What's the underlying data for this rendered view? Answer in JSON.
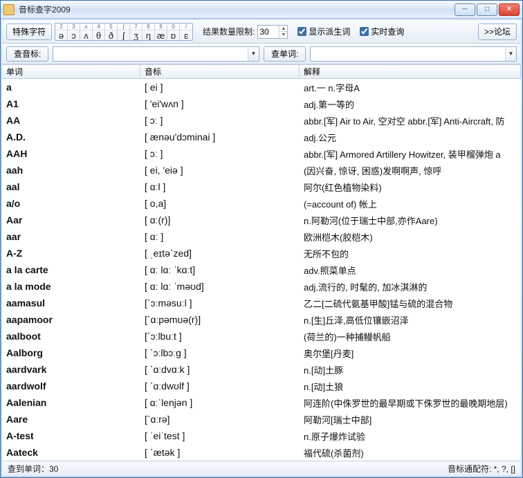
{
  "title": "音标查字2009",
  "winbtns": {
    "min": "─",
    "max": "□",
    "close": "✕"
  },
  "toolbar": {
    "special_label": "特殊字符",
    "ipa_cells": [
      {
        "n": "2",
        "s": "ə"
      },
      {
        "n": "3",
        "s": "ɔ"
      },
      {
        "n": "ʌ",
        "s": "ʌ"
      },
      {
        "n": "4",
        "s": "θ"
      },
      {
        "n": "5",
        "s": "ð"
      },
      {
        "n": "ʃ",
        "s": "ʃ"
      },
      {
        "n": "7",
        "s": "ʒ"
      },
      {
        "n": "8",
        "s": "ŋ"
      },
      {
        "n": "9",
        "s": "æ"
      },
      {
        "n": "0",
        "s": "ɒ"
      },
      {
        "n": "/",
        "s": "ɛ"
      }
    ],
    "limit_label": "结果数量限制:",
    "limit_value": "30",
    "chk_derive": "显示派生词",
    "chk_live": "实时查询",
    "forum_label": ">>论坛"
  },
  "searchbar": {
    "ipa_label": "查音标:",
    "ipa_value": "",
    "word_label": "查单词:",
    "word_value": ""
  },
  "columns": {
    "word": "单词",
    "ipa": "音标",
    "def": "解释"
  },
  "rows": [
    {
      "word": "a",
      "ipa": "[  ei ]",
      "def": "art.一  n.字母A"
    },
    {
      "word": "A1",
      "ipa": "[  'ei'wʌn ]",
      "def": "adj.第一等的"
    },
    {
      "word": "AA",
      "ipa": "[  ɔː ]",
      "def": "abbr.[军] Air to Air, 空对空  abbr.[军] Anti-Aircraft, 防"
    },
    {
      "word": "A.D.",
      "ipa": "[  ænəu'dɔminai ]",
      "def": "adj.公元"
    },
    {
      "word": "AAH",
      "ipa": "[  ɔː ]",
      "def": "abbr.[军] Armored Artillery Howitzer, 装甲榴弹炮  a"
    },
    {
      "word": "aah",
      "ipa": "[  ei, 'eiə ]",
      "def": "(因兴奋, 惊讶, 困惑)发啊啊声, 惊呼"
    },
    {
      "word": "aal",
      "ipa": "[  ɑːl ]",
      "def": "阿尔(红色植物染料)"
    },
    {
      "word": "a/o",
      "ipa": "[  o,a]",
      "def": "(=account of) 帐上"
    },
    {
      "word": "Aar",
      "ipa": "[ ɑː(r)]",
      "def": "n.阿勒河(位于瑞士中部,亦作Aare)"
    },
    {
      "word": "aar",
      "ipa": "[   ɑː ]",
      "def": "欧洲桤木(胶桤木)"
    },
    {
      "word": "A-Z",
      "ipa": "[  ˌeɪtəˋzed]",
      "def": "无所不包的"
    },
    {
      "word": "a la carte",
      "ipa": "[  ɑː lɑː ˈkɑːt]",
      "def": "adv.照菜单点"
    },
    {
      "word": "a la mode",
      "ipa": "[  ɑː lɑː ˈməʊd]",
      "def": "adj.流行的, 时髦的, 加冰淇淋的"
    },
    {
      "word": "aamasul",
      "ipa": "[ˋɔːməsuːl ]",
      "def": "乙二[二硫代氨基甲酸]锰与硫的混合物"
    },
    {
      "word": "aapamoor",
      "ipa": "[ˋɑːpəmʊə(r)]",
      "def": "n.[生]丘泽,高低位镶嵌沼泽"
    },
    {
      "word": "aalboot",
      "ipa": "[ˋɔːlbuːt ]",
      "def": "(荷兰的)一种捕鳗帆船"
    },
    {
      "word": "Aalborg",
      "ipa": "[ ˋɔːlbɔːɡ ]",
      "def": "奥尔堡[丹麦]"
    },
    {
      "word": "aardvark",
      "ipa": "[ ˋɑːdvɑːk ]",
      "def": "n.[动]土豚"
    },
    {
      "word": "aardwolf",
      "ipa": "[ ˋɑːdwʊlf ]",
      "def": "n.[动]土狼"
    },
    {
      "word": "Aalenian",
      "ipa": "[  ɑːˈlenjən ]",
      "def": "阿连阶(中侏罗世的最早期或下侏罗世的最晚期地层)"
    },
    {
      "word": "Aare",
      "ipa": "[ˋɑːrə]",
      "def": "阿勒河[瑞士中部]"
    },
    {
      "word": "A-test",
      "ipa": "[  ˈeiˈtest ]",
      "def": "n.原子爆炸试验"
    },
    {
      "word": "Aateck",
      "ipa": "[ ˋætək ]",
      "def": "福代硫(杀菌剂)"
    }
  ],
  "status": {
    "left": "查到单词：30",
    "right": "音标通配符: *, ?, []"
  }
}
